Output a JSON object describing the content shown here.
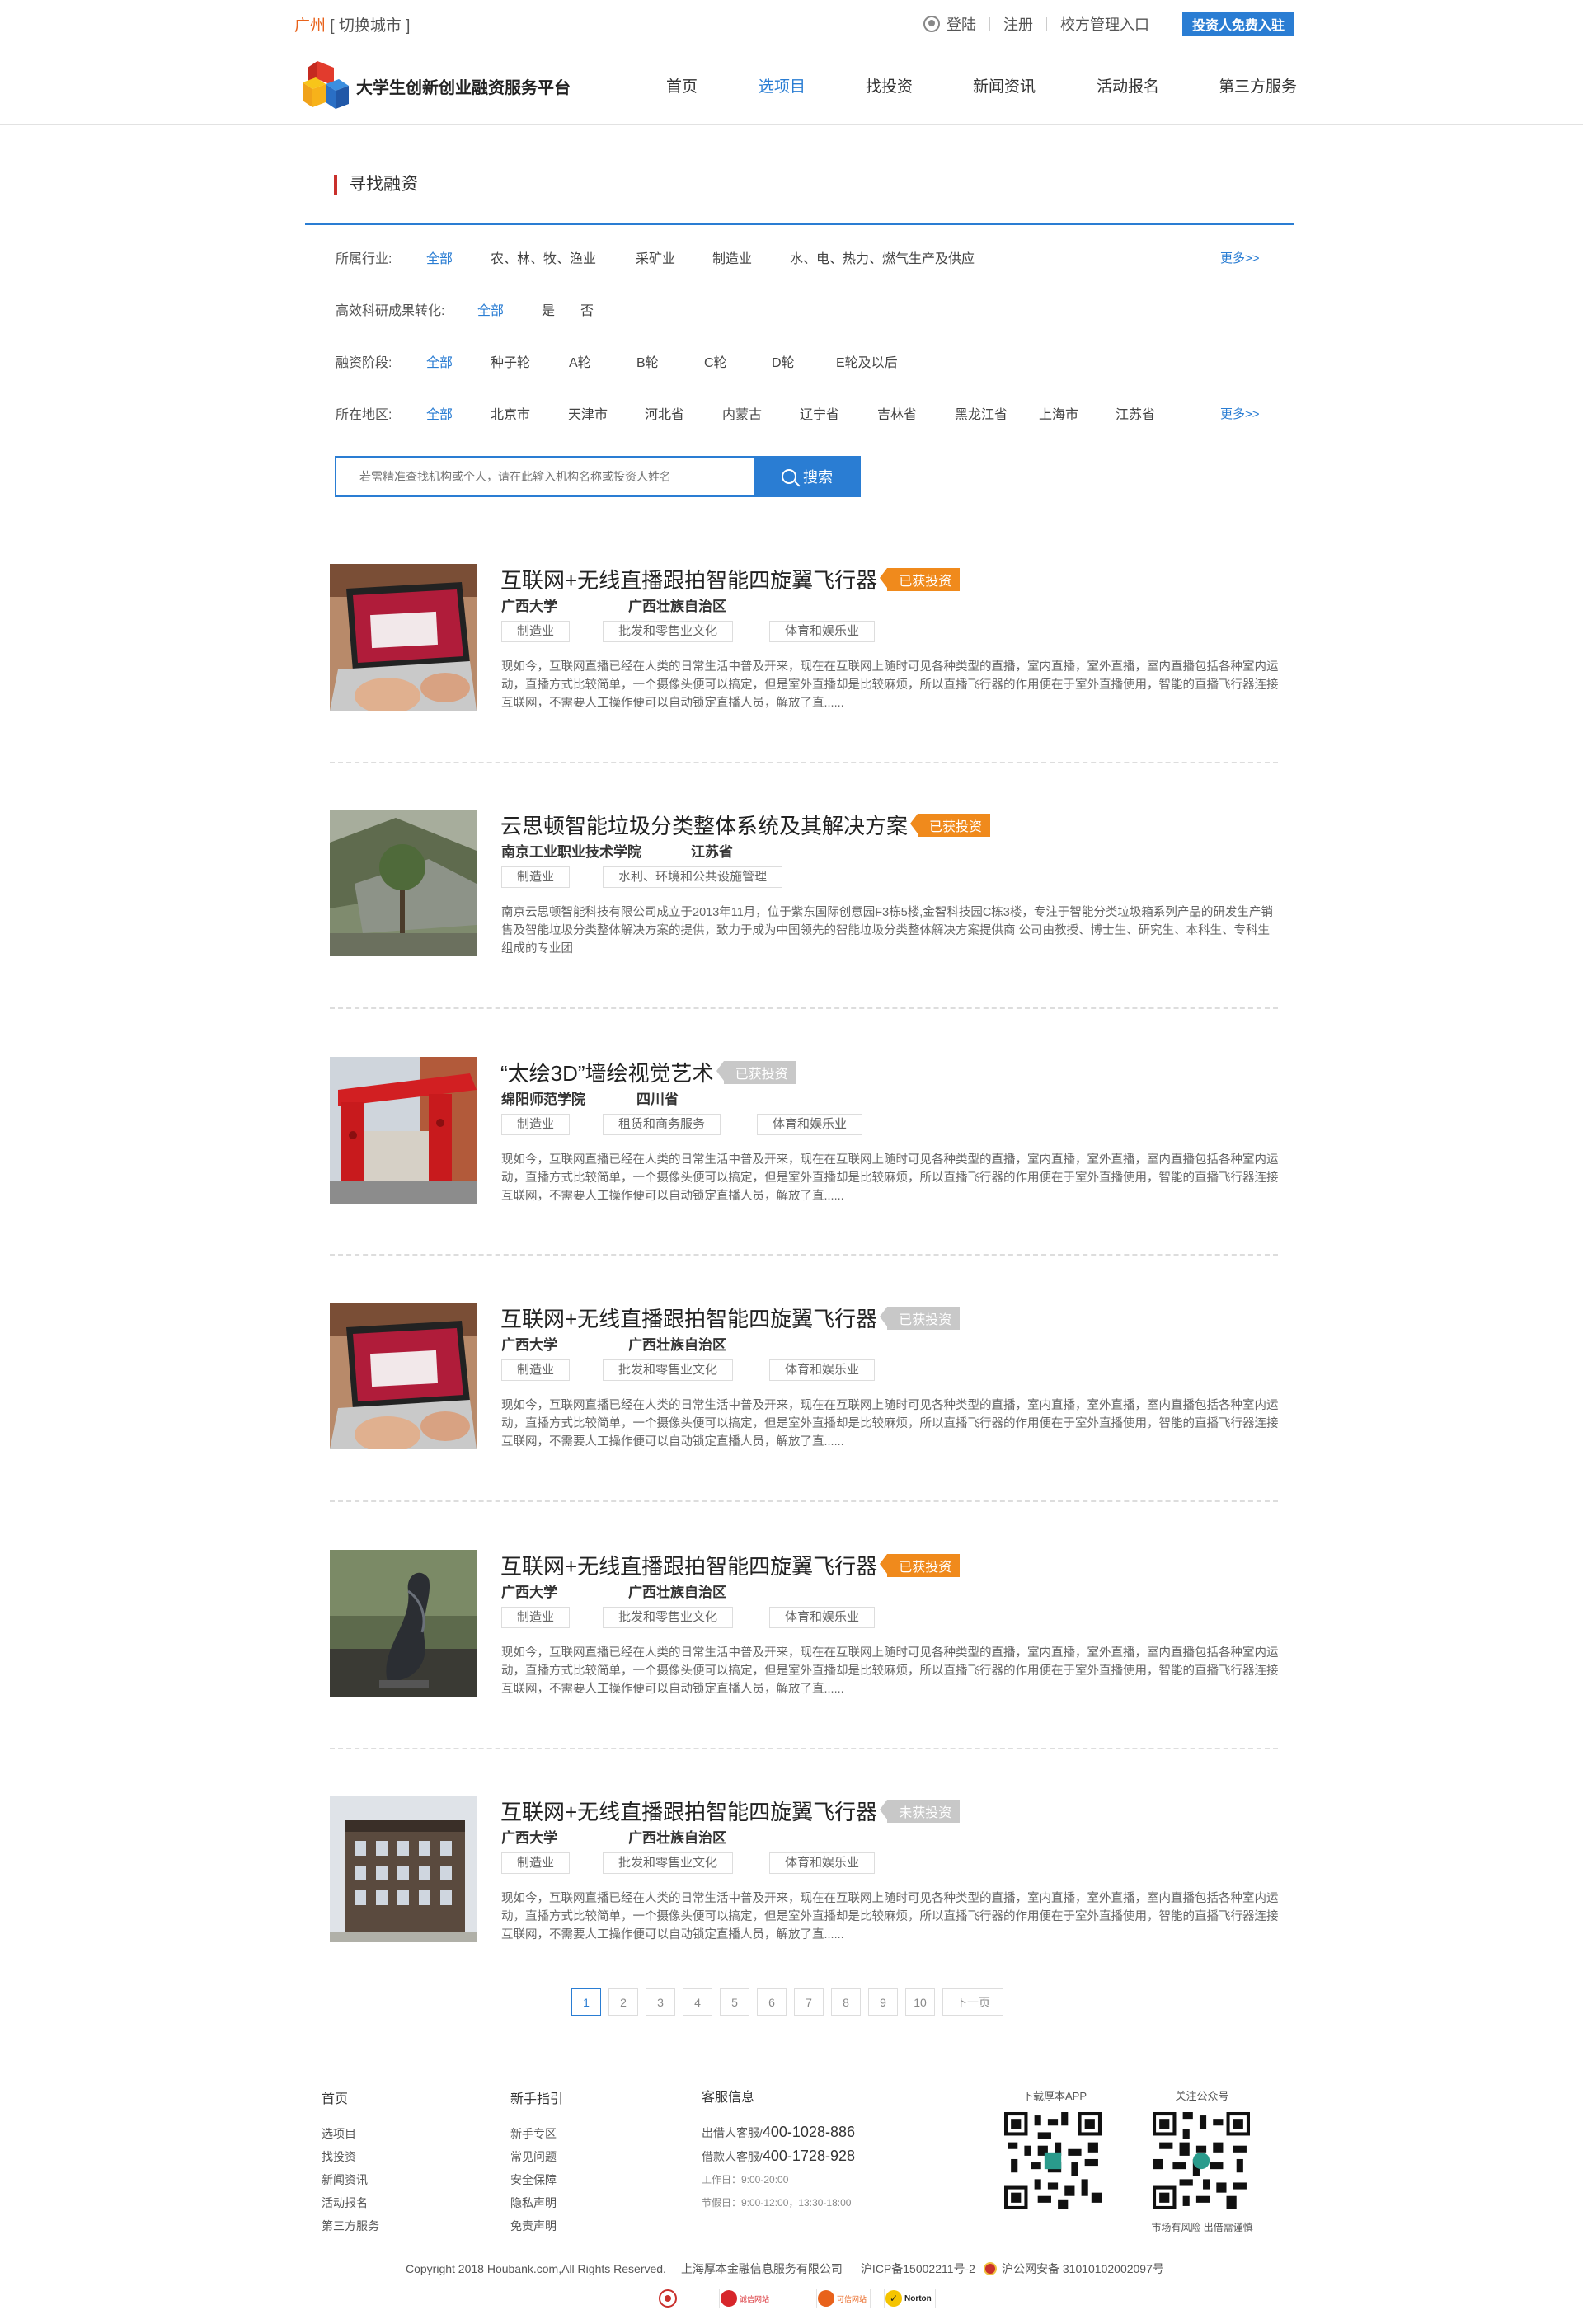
{
  "topbar": {
    "city": "广州",
    "switch_city": "[ 切换城市 ]",
    "login": "登陆",
    "register": "注册",
    "school_entry": "校方管理入口",
    "investor_btn": "投资人免费入驻"
  },
  "nav": {
    "logo_text": "大学生创新创业融资服务平台",
    "items": [
      "首页",
      "选项目",
      "找投资",
      "新闻资讯",
      "活动报名",
      "第三方服务"
    ],
    "active_index": 1
  },
  "section": {
    "title": "寻找融资"
  },
  "filters": {
    "industry": {
      "label": "所属行业:",
      "options": [
        "全部",
        "农、林、牧、渔业",
        "采矿业",
        "制造业",
        "水、电、热力、燃气生产及供应"
      ],
      "more": "更多>>"
    },
    "research": {
      "label": "高效科研成果转化:",
      "options": [
        "全部",
        "是",
        "否"
      ]
    },
    "stage": {
      "label": "融资阶段:",
      "options": [
        "全部",
        "种子轮",
        "A轮",
        "B轮",
        "C轮",
        "D轮",
        "E轮及以后"
      ]
    },
    "region": {
      "label": "所在地区:",
      "options": [
        "全部",
        "北京市",
        "天津市",
        "河北省",
        "内蒙古",
        "辽宁省",
        "吉林省",
        "黑龙江省",
        "上海市",
        "江苏省"
      ],
      "more": "更多>>"
    }
  },
  "search": {
    "placeholder": "若需精准查找机构或个人，请在此输入机构名称或投资人姓名",
    "button": "搜索"
  },
  "projects": [
    {
      "title": "互联网+无线直播跟拍智能四旋翼飞行器",
      "badge": "已获投资",
      "badge_status": "invested",
      "school": "广西大学",
      "region": "广西壮族自治区",
      "tags": [
        "制造业",
        "批发和零售业文化",
        "体育和娱乐业"
      ],
      "desc": "现如今，互联网直播已经在人类的日常生活中普及开来，现在在互联网上随时可见各种类型的直播，室内直播，室外直播，室内直播包括各种室内运动，直播方式比较简单，一个摄像头便可以搞定，但是室外直播却是比较麻烦，所以直播飞行器的作用便在于室外直播使用，智能的直播飞行器连接互联网，不需要人工操作便可以自动锁定直播人员，解放了直......",
      "image": "laptop"
    },
    {
      "title": "云思顿智能垃圾分类整体系统及其解决方案",
      "badge": "已获投资",
      "badge_status": "invested",
      "school": "南京工业职业技术学院",
      "region": "江苏省",
      "tags": [
        "制造业",
        "水利、环境和公共设施管理"
      ],
      "desc": "南京云思顿智能科技有限公司成立于2013年11月，位于紫东国际创意园F3栋5楼,金智科技园C栋3楼，专注于智能分类垃圾箱系列产品的研发生产销售及智能垃圾分类整体解决方案的提供，致力于成为中国领先的智能垃圾分类整体解决方案提供商 公司由教授、博士生、研究生、本科生、专科生组成的专业团",
      "image": "park"
    },
    {
      "title": "“太绘3D”墙绘视觉艺术",
      "badge": "已获投资",
      "badge_status": "gray",
      "school": "绵阳师范学院",
      "region": "四川省",
      "tags": [
        "制造业",
        "租赁和商务服务",
        "体育和娱乐业"
      ],
      "desc": "现如今，互联网直播已经在人类的日常生活中普及开来，现在在互联网上随时可见各种类型的直播，室内直播，室外直播，室内直播包括各种室内运动，直播方式比较简单，一个摄像头便可以搞定，但是室外直播却是比较麻烦，所以直播飞行器的作用便在于室外直播使用，智能的直播飞行器连接互联网，不需要人工操作便可以自动锁定直播人员，解放了直......",
      "image": "gate"
    },
    {
      "title": "互联网+无线直播跟拍智能四旋翼飞行器",
      "badge": "已获投资",
      "badge_status": "gray",
      "school": "广西大学",
      "region": "广西壮族自治区",
      "tags": [
        "制造业",
        "批发和零售业文化",
        "体育和娱乐业"
      ],
      "desc": "现如今，互联网直播已经在人类的日常生活中普及开来，现在在互联网上随时可见各种类型的直播，室内直播，室外直播，室内直播包括各种室内运动，直播方式比较简单，一个摄像头便可以搞定，但是室外直播却是比较麻烦，所以直播飞行器的作用便在于室外直播使用，智能的直播飞行器连接互联网，不需要人工操作便可以自动锁定直播人员，解放了直......",
      "image": "laptop"
    },
    {
      "title": "互联网+无线直播跟拍智能四旋翼飞行器",
      "badge": "已获投资",
      "badge_status": "invested",
      "school": "广西大学",
      "region": "广西壮族自治区",
      "tags": [
        "制造业",
        "批发和零售业文化",
        "体育和娱乐业"
      ],
      "desc": "现如今，互联网直播已经在人类的日常生活中普及开来，现在在互联网上随时可见各种类型的直播，室内直播，室外直播，室内直播包括各种室内运动，直播方式比较简单，一个摄像头便可以搞定，但是室外直播却是比较麻烦，所以直播飞行器的作用便在于室外直播使用，智能的直播飞行器连接互联网，不需要人工操作便可以自动锁定直播人员，解放了直......",
      "image": "sculpture"
    },
    {
      "title": "互联网+无线直播跟拍智能四旋翼飞行器",
      "badge": "未获投资",
      "badge_status": "gray",
      "school": "广西大学",
      "region": "广西壮族自治区",
      "tags": [
        "制造业",
        "批发和零售业文化",
        "体育和娱乐业"
      ],
      "desc": "现如今，互联网直播已经在人类的日常生活中普及开来，现在在互联网上随时可见各种类型的直播，室内直播，室外直播，室内直播包括各种室内运动，直播方式比较简单，一个摄像头便可以搞定，但是室外直播却是比较麻烦，所以直播飞行器的作用便在于室外直播使用，智能的直播飞行器连接互联网，不需要人工操作便可以自动锁定直播人员，解放了直......",
      "image": "building"
    }
  ],
  "pager": {
    "pages": [
      "1",
      "2",
      "3",
      "4",
      "5",
      "6",
      "7",
      "8",
      "9",
      "10"
    ],
    "next": "下一页",
    "current": 1
  },
  "footer": {
    "col1": {
      "title": "首页",
      "items": [
        "选项目",
        "找投资",
        "新闻资讯",
        "活动报名",
        "第三方服务"
      ]
    },
    "col2": {
      "title": "新手指引",
      "items": [
        "新手专区",
        "常见问题",
        "安全保障",
        "隐私声明",
        "免责声明"
      ]
    },
    "col3": {
      "title": "客服信息",
      "lender_label": "出借人客服/",
      "lender_phone": "400-1028-886",
      "borrower_label": "借款人客服/",
      "borrower_phone": "400-1728-928",
      "workday": "工作日：9:00-20:00",
      "holiday": "节假日：9:00-12:00，13:30-18:00"
    },
    "app_title": "下载厚本APP",
    "wechat_title": "关注公众号",
    "risk_note": "市场有风险  出借需谨慎",
    "copyright": "Copyright 2018 Houbank.com,All Rights Reserved.",
    "company": "上海厚本金融信息服务有限公司",
    "icp": "沪ICP备15002211号-2",
    "police": "沪公网安备 31010102002097号",
    "badge_labels": [
      "诚信网站",
      "可信网站",
      "Norton"
    ]
  },
  "colors": {
    "primary": "#2a7dd3",
    "accent_orange": "#f08a1c",
    "title_red": "#c9302c",
    "city_orange": "#e8621b"
  }
}
